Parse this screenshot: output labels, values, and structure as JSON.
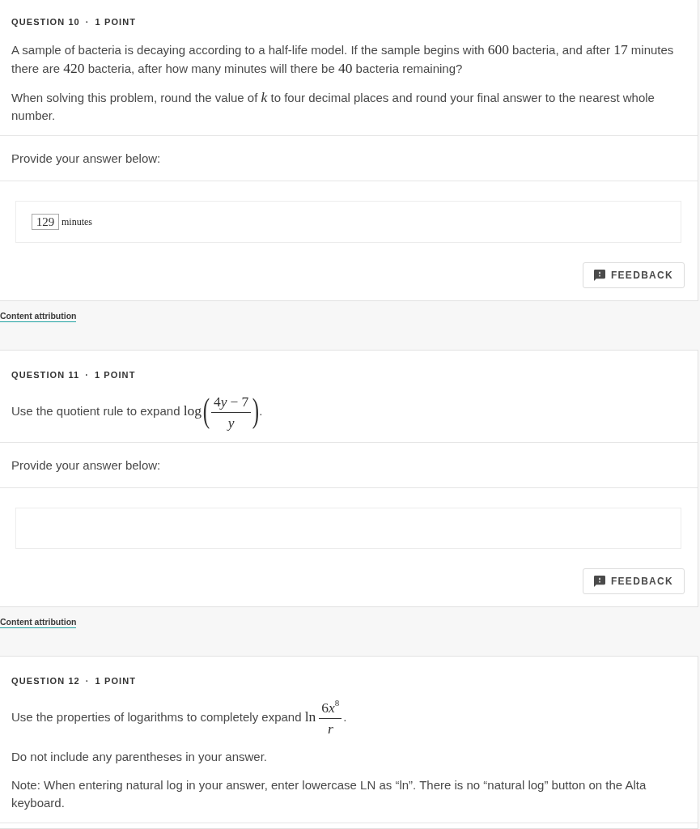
{
  "questions": [
    {
      "label": "QUESTION 10",
      "separator": "·",
      "points": "1 POINT",
      "prompt": [
        [
          {
            "kind": "text",
            "text": "A sample of bacteria is decaying according to a half-life model. If the sample begins with "
          },
          {
            "kind": "number",
            "text": "600"
          },
          {
            "kind": "text",
            "text": " bacteria, and after "
          },
          {
            "kind": "number",
            "text": "17"
          },
          {
            "kind": "text",
            "text": " minutes there are "
          },
          {
            "kind": "number",
            "text": "420"
          },
          {
            "kind": "text",
            "text": " bacteria, after how many minutes will there be "
          },
          {
            "kind": "number",
            "text": "40"
          },
          {
            "kind": "text",
            "text": " bacteria remaining?"
          }
        ],
        [
          {
            "kind": "text",
            "text": "When solving this problem, round the value of "
          },
          {
            "kind": "variable",
            "text": "k"
          },
          {
            "kind": "text",
            "text": " to four decimal places and round your final answer to the nearest whole number."
          }
        ]
      ],
      "answer_prompt": "Provide your answer below:",
      "answer": {
        "kind": "inline",
        "value": "129",
        "unit": "minutes"
      },
      "feedback_button": "FEEDBACK",
      "attribution_link": "Content attribution"
    },
    {
      "label": "QUESTION 11",
      "separator": "·",
      "points": "1 POINT",
      "prompt": [
        [
          {
            "kind": "text",
            "text": "Use the quotient rule to expand "
          },
          {
            "kind": "function",
            "text": "log"
          },
          {
            "kind": "delimiter",
            "text": "("
          },
          {
            "kind": "fraction",
            "numerator": [
              {
                "kind": "number",
                "text": "4"
              },
              {
                "kind": "variable",
                "text": "y"
              },
              {
                "kind": "operator",
                "text": "−"
              },
              {
                "kind": "number",
                "text": "7"
              }
            ],
            "denominator": [
              {
                "kind": "variable",
                "text": "y"
              }
            ]
          },
          {
            "kind": "delimiter",
            "text": ")"
          },
          {
            "kind": "text",
            "text": "."
          }
        ]
      ],
      "answer_prompt": "Provide your answer below:",
      "answer": {
        "kind": "box"
      },
      "feedback_button": "FEEDBACK",
      "attribution_link": "Content attribution"
    },
    {
      "label": "QUESTION 12",
      "separator": "·",
      "points": "1 POINT",
      "prompt": [
        [
          {
            "kind": "text",
            "text": "Use the properties of logarithms to completely expand "
          },
          {
            "kind": "function",
            "text": "ln"
          },
          {
            "kind": "fraction",
            "numerator": [
              {
                "kind": "number",
                "text": "6"
              },
              {
                "kind": "variable",
                "text": "x"
              },
              {
                "kind": "superscript",
                "text": "8"
              }
            ],
            "denominator": [
              {
                "kind": "variable",
                "text": "r"
              }
            ]
          },
          {
            "kind": "text",
            "text": "."
          }
        ],
        [
          {
            "kind": "text",
            "text": "Do not include any parentheses in your answer."
          }
        ],
        [
          {
            "kind": "text",
            "text": "Note: When entering natural log in your answer, enter lowercase LN as “ln”. There is no “natural log” button on the Alta keyboard."
          }
        ]
      ]
    }
  ]
}
